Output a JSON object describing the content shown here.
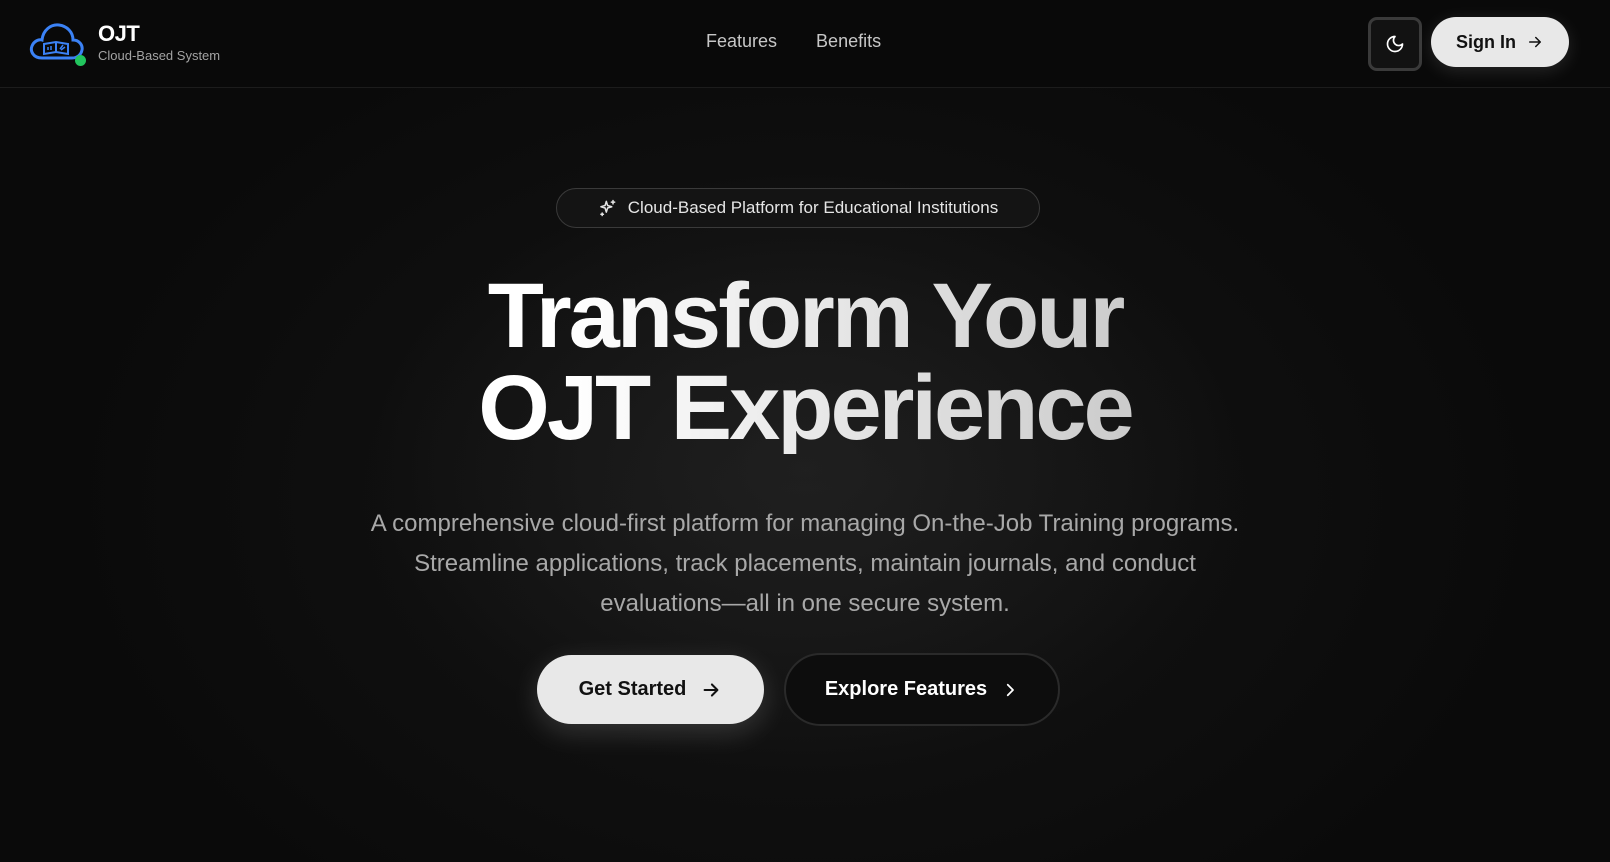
{
  "brand": {
    "title": "OJT",
    "subtitle": "Cloud-Based System",
    "logo_icon": "cloud-book-icon",
    "status_color": "#22c55e"
  },
  "nav": {
    "items": [
      "Features",
      "Benefits"
    ]
  },
  "header_actions": {
    "theme_icon": "moon-icon",
    "signin_label": "Sign In",
    "signin_icon": "arrow-right-icon"
  },
  "hero": {
    "badge_icon": "sparkles-icon",
    "badge_text": "Cloud-Based Platform for Educational Institutions",
    "title_line1": "Transform Your",
    "title_line2": "OJT Experience",
    "description": "A comprehensive cloud-first platform for managing On-the-Job Training programs. Streamline applications, track placements, maintain journals, and conduct evaluations—all in one secure system.",
    "primary_label": "Get Started",
    "primary_icon": "arrow-right-icon",
    "secondary_label": "Explore Features",
    "secondary_icon": "chevron-right-icon"
  },
  "colors": {
    "background": "#0b0b0b",
    "accent": "#3b82f6",
    "button_light": "#e8e8e8"
  }
}
